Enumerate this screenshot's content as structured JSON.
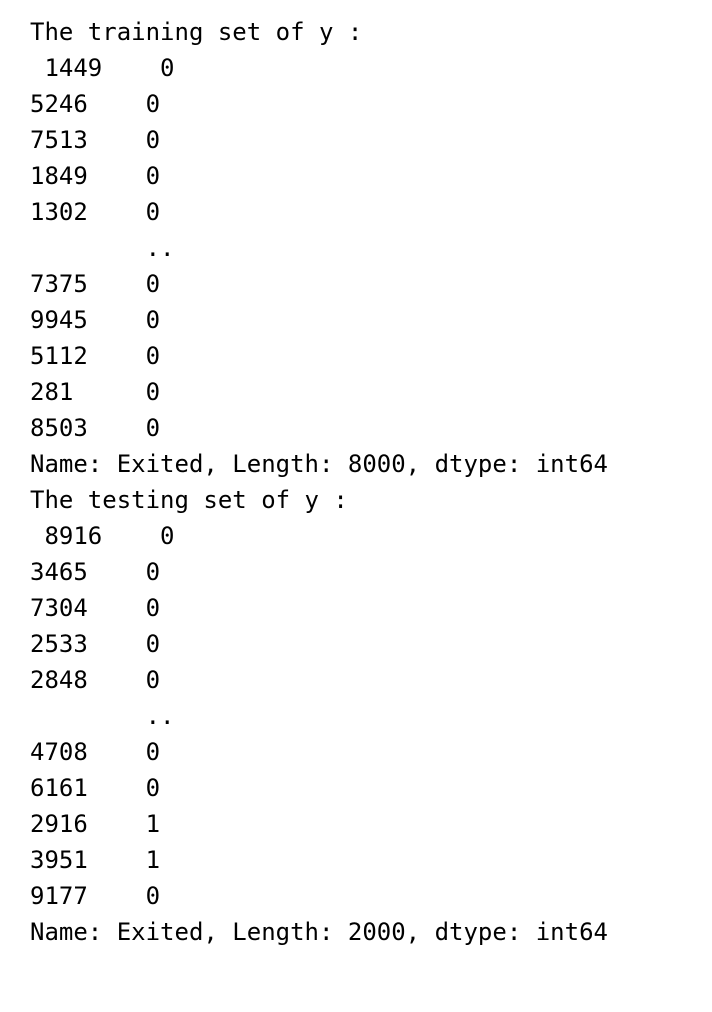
{
  "output": {
    "lines": [
      "The training set of y :",
      " 1449    0",
      "5246    0",
      "7513    0",
      "1849    0",
      "1302    0",
      "        ..",
      "7375    0",
      "9945    0",
      "5112    0",
      "281     0",
      "8503    0",
      "Name: Exited, Length: 8000, dtype: int64",
      "The testing set of y :",
      " 8916    0",
      "3465    0",
      "7304    0",
      "2533    0",
      "2848    0",
      "        ..",
      "4708    0",
      "6161    0",
      "2916    1",
      "3951    1",
      "9177    0",
      "Name: Exited, Length: 2000, dtype: int64"
    ]
  }
}
